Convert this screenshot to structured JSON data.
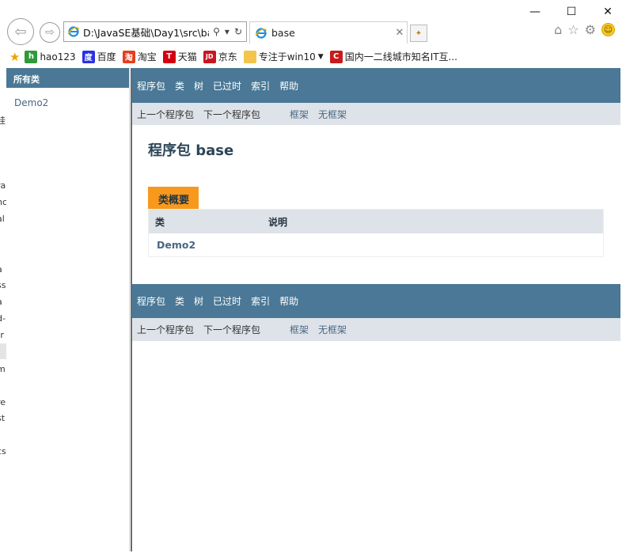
{
  "window": {
    "controls": [
      "—",
      "☐",
      "✕"
    ]
  },
  "navbar": {
    "back_glyph": "⇦",
    "forward_glyph": "⇨",
    "address": "D:\\JavaSE基础\\Day1\\src\\ba",
    "search_glyph": "⚲",
    "dropdown_glyph": "▾",
    "refresh_glyph": "↻",
    "tab_title": "base",
    "tab_close": "✕",
    "newtab_glyph": "✦",
    "home_glyph": "⌂",
    "star_glyph": "☆",
    "gear_glyph": "⚙",
    "smiley_glyph": "☺"
  },
  "favorites": [
    {
      "label": "hao123",
      "icon": "hao123-icon",
      "color": "#2e9a3a",
      "glyph": "h"
    },
    {
      "label": "百度",
      "icon": "baidu-icon",
      "color": "#2932e1",
      "glyph": "度"
    },
    {
      "label": "淘宝",
      "icon": "taobao-icon",
      "color": "#e63d1f",
      "glyph": "淘"
    },
    {
      "label": "天猫",
      "icon": "tmall-icon",
      "color": "#d40010",
      "glyph": "T"
    },
    {
      "label": "京东",
      "icon": "jd-icon",
      "color": "#c91623",
      "glyph": "JD"
    },
    {
      "label": "专注于win10",
      "icon": "folder-icon",
      "color": "#f3c54b",
      "glyph": ""
    },
    {
      "label": "国内一二线城市知名IT互...",
      "icon": "csdn-icon",
      "color": "#c81b1b",
      "glyph": "C"
    }
  ],
  "favorites_star_glyph": "★",
  "left_frame": {
    "header": "所有类",
    "classes": [
      "Demo2"
    ]
  },
  "truncated_text": [
    "挂",
    "ra",
    "nc",
    "al",
    "a",
    "ss",
    "a",
    "d-",
    "tr",
    "m",
    "re",
    "st",
    "cs"
  ],
  "nav": {
    "items": [
      "程序包",
      "类",
      "树",
      "已过时",
      "索引",
      "帮助"
    ],
    "prev": "上一个程序包",
    "next": "下一个程序包",
    "frames": "框架",
    "noframes": "无框架"
  },
  "package": {
    "title": "程序包 base",
    "summary_caption": "类概要",
    "col_class": "类",
    "col_desc": "说明",
    "rows": [
      {
        "name": "Demo2",
        "desc": ""
      }
    ]
  },
  "colors": {
    "nav_bg": "#4a7896",
    "subnav_bg": "#dee3e9",
    "caption_bg": "#f8981d",
    "link": "#4a6782"
  }
}
